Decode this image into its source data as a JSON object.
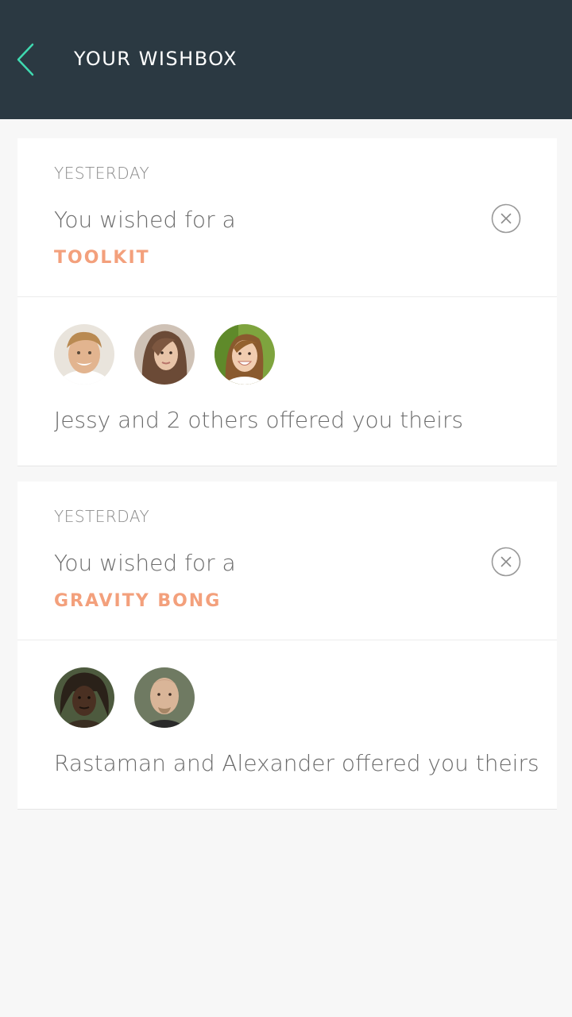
{
  "header": {
    "title": "YOUR WISHBOX",
    "back_icon": "chevron-left-icon",
    "accent_color": "#3fd9b0"
  },
  "wishes": [
    {
      "date": "YESTERDAY",
      "wish_line": "You wished for a",
      "item": "TOOLKIT",
      "remove_icon": "close-circle-icon",
      "avatars": [
        "avatar-young-man",
        "avatar-long-hair-woman",
        "avatar-smiling-woman"
      ],
      "offer_text": "Jessy and 2 others offered you theirs"
    },
    {
      "date": "YESTERDAY",
      "wish_line": "You wished for a",
      "item": "GRAVITY BONG",
      "remove_icon": "close-circle-icon",
      "avatars": [
        "avatar-dreadlocks-man",
        "avatar-bald-man"
      ],
      "offer_text": "Rastaman and Alexander offered you theirs"
    }
  ],
  "colors": {
    "header_bg": "#2b3942",
    "item_accent": "#f3a07c",
    "page_bg": "#f7f7f7"
  }
}
